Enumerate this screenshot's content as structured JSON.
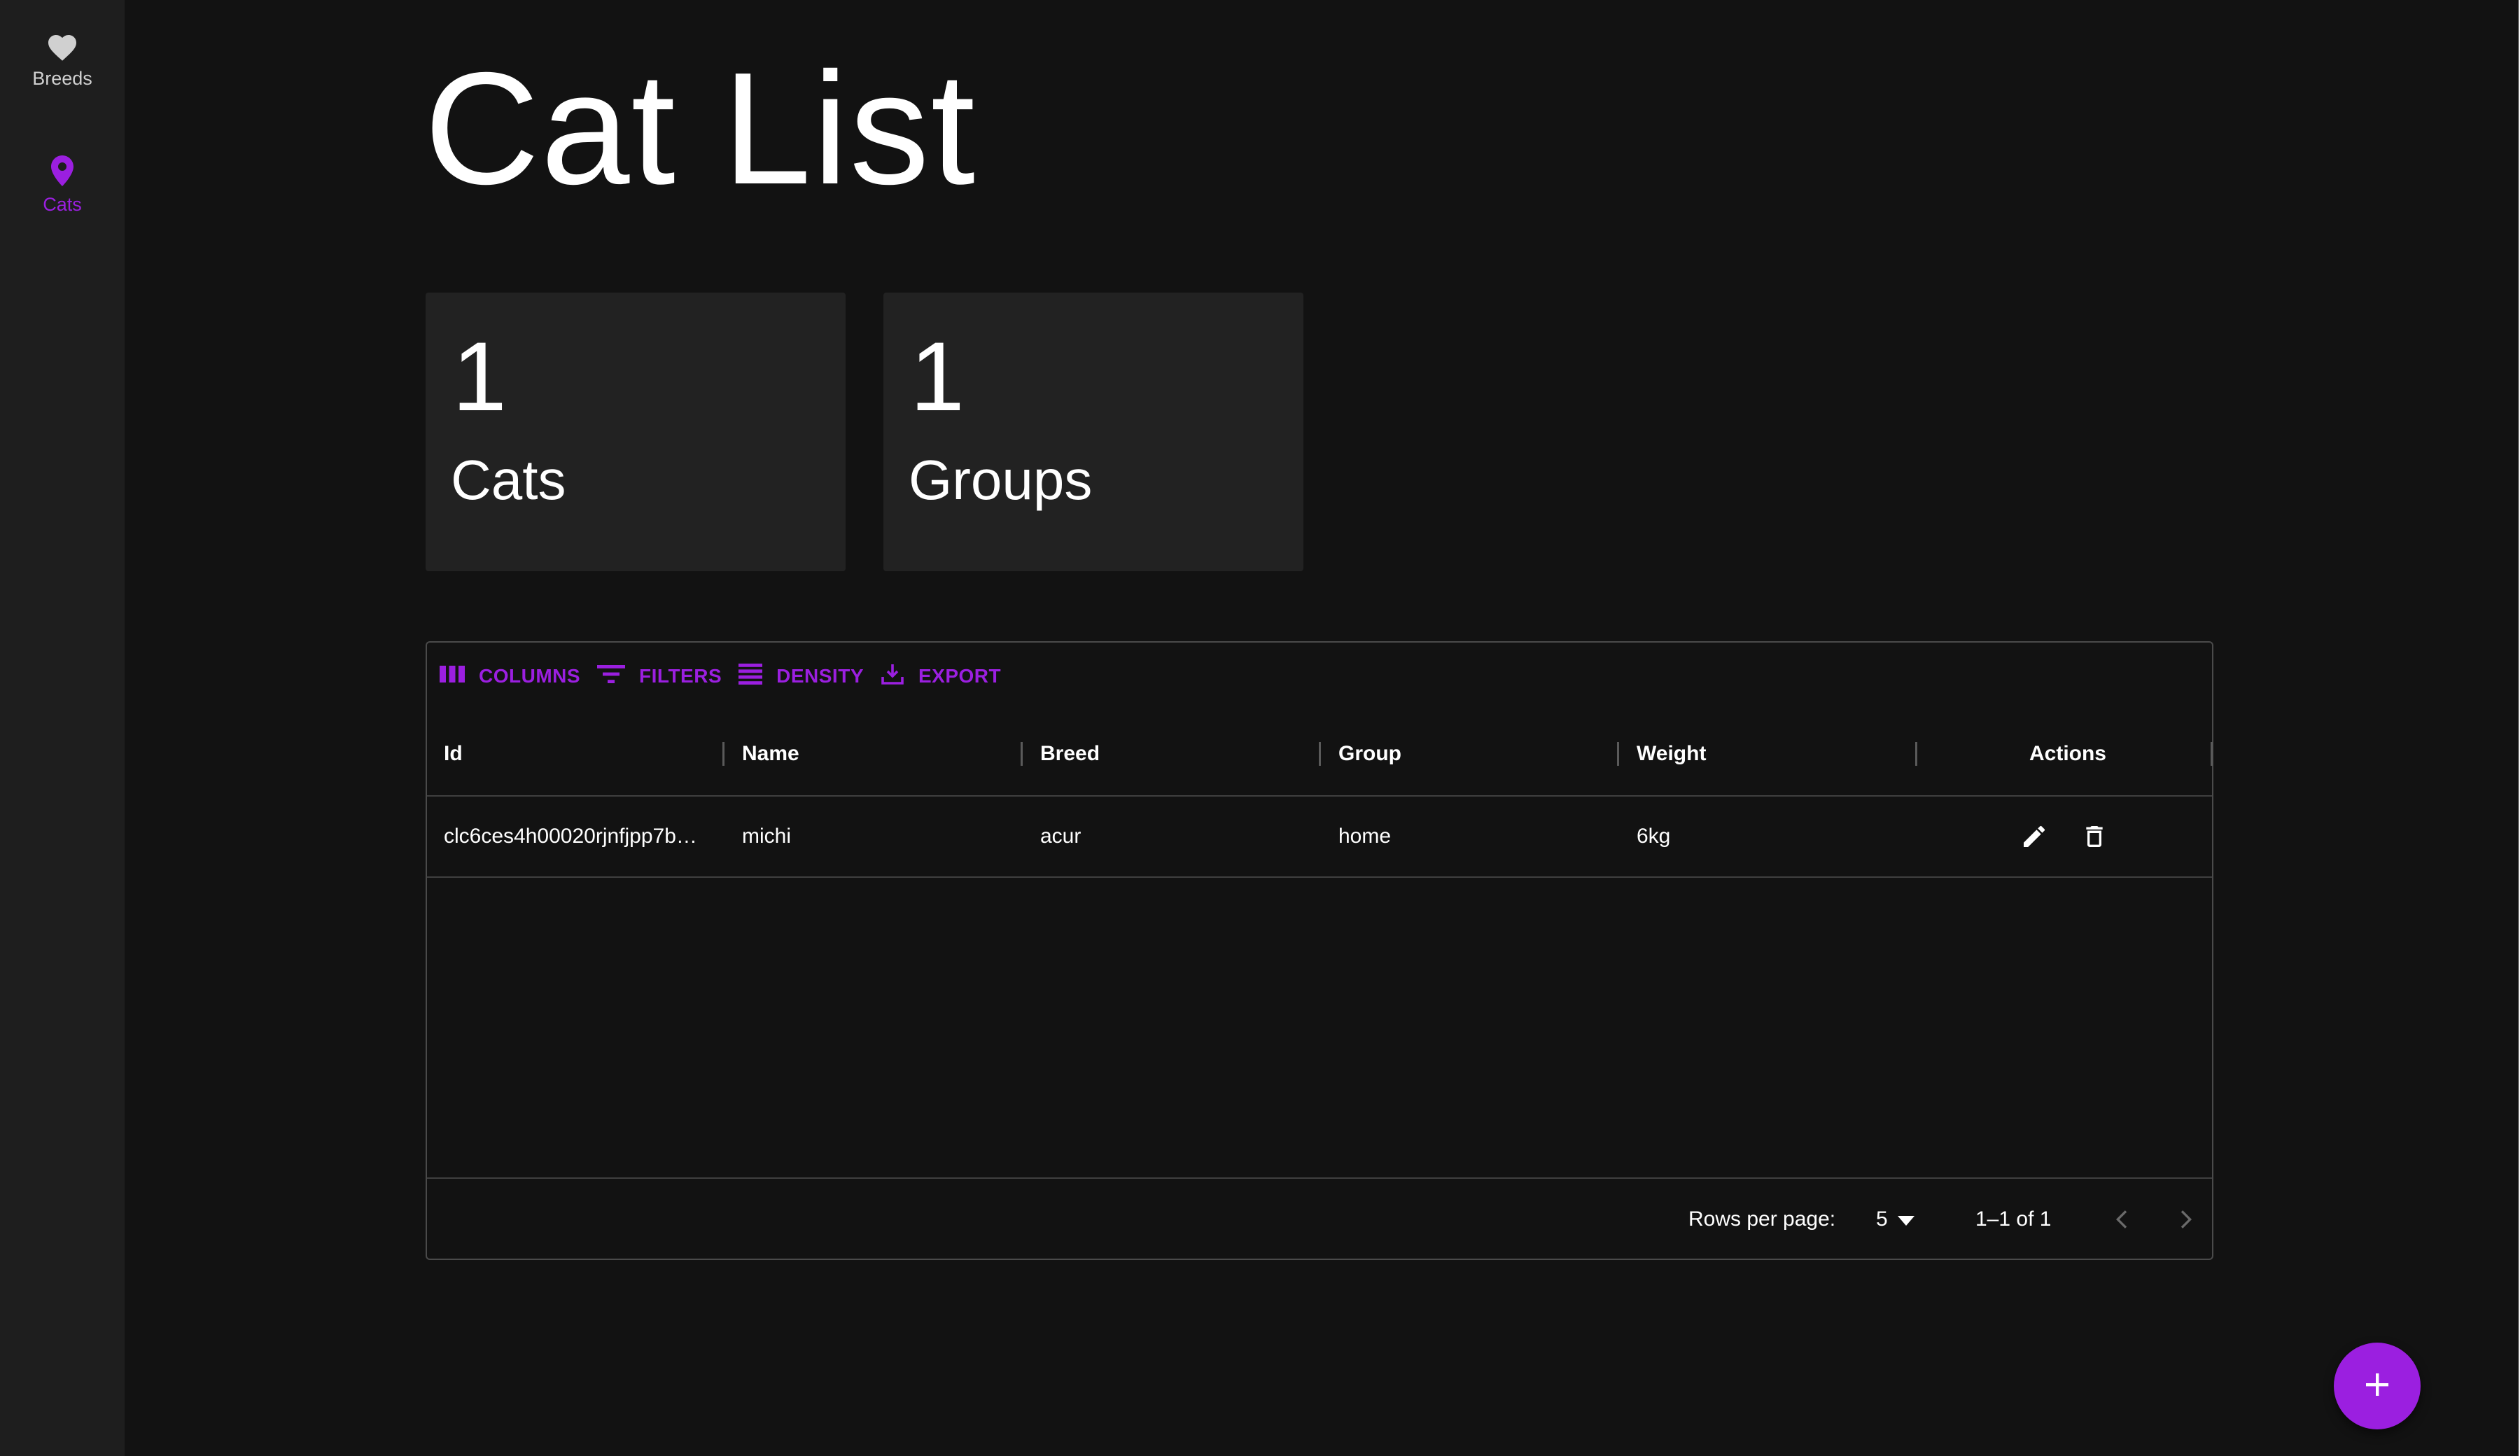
{
  "nav": {
    "items": [
      {
        "label": "Breeds",
        "icon": "heart-icon",
        "active": false
      },
      {
        "label": "Cats",
        "icon": "location-pin-icon",
        "active": true
      }
    ]
  },
  "page": {
    "title": "Cat List"
  },
  "stats": [
    {
      "value": "1",
      "label": "Cats"
    },
    {
      "value": "1",
      "label": "Groups"
    }
  ],
  "toolbar": {
    "columns_label": "COLUMNS",
    "filters_label": "FILTERS",
    "density_label": "DENSITY",
    "export_label": "EXPORT"
  },
  "table": {
    "columns": [
      "Id",
      "Name",
      "Breed",
      "Group",
      "Weight",
      "Actions"
    ],
    "rows": [
      {
        "id": "clc6ces4h00020rjnfjpp7b…",
        "name": "michi",
        "breed": "acur",
        "group": "home",
        "weight": "6kg"
      }
    ]
  },
  "pagination": {
    "rows_per_page_label": "Rows per page:",
    "rows_per_page_value": "5",
    "range_text": "1–1 of 1"
  },
  "colors": {
    "accent": "#9b1fe0",
    "background": "#121212",
    "sidebar": "#1e1e1e",
    "card": "#222222"
  }
}
